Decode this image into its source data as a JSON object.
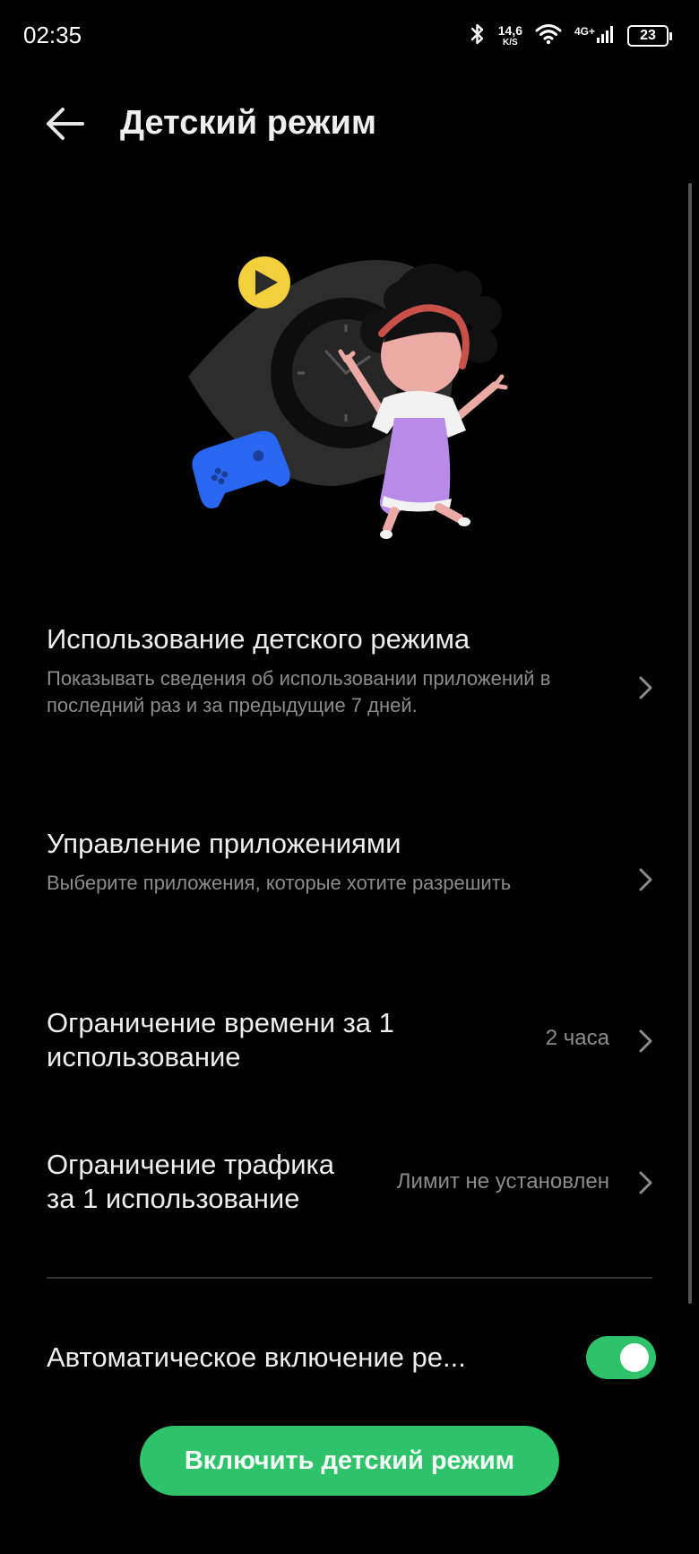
{
  "status_bar": {
    "time": "02:35",
    "speed_value": "14,6",
    "speed_unit": "K/S",
    "network": "4G+",
    "battery": "23"
  },
  "header": {
    "title": "Детский режим"
  },
  "settings": [
    {
      "title": "Использование детского режима",
      "subtitle": "Показывать сведения об использовании приложений в последний раз и за предыдущие 7 дней."
    },
    {
      "title": "Управление приложениями",
      "subtitle": "Выберите приложения, которые хотите разрешить"
    },
    {
      "title": "Ограничение времени за 1 использование",
      "value": "2 часа"
    },
    {
      "title": "Ограничение трафика за 1 использование",
      "value": "Лимит не установлен"
    }
  ],
  "auto_enable": {
    "label": "Автоматическое включение ре...",
    "enabled": true
  },
  "primary_button": {
    "label": "Включить детский режим"
  },
  "colors": {
    "accent": "#2ec36a",
    "background": "#000000",
    "secondary_text": "#8c8c8c"
  }
}
